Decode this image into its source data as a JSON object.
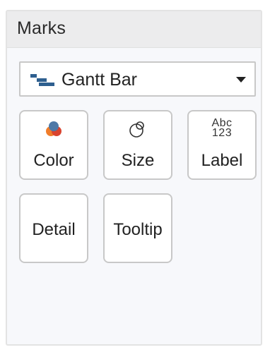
{
  "marks": {
    "title": "Marks",
    "mark_type": {
      "selected": "Gantt Bar",
      "icon": "gantt-bar-icon"
    },
    "cards": [
      {
        "label": "Color",
        "icon": "color-palette-icon"
      },
      {
        "label": "Size",
        "icon": "size-circles-icon"
      },
      {
        "label": "Label",
        "icon": "label-abc123-icon",
        "icon_text_top": "Abc",
        "icon_text_bottom": "123"
      },
      {
        "label": "Detail",
        "icon": ""
      },
      {
        "label": "Tooltip",
        "icon": ""
      }
    ],
    "colors": {
      "gantt_dark": "#1f4e79",
      "gantt_light": "#4f81bd",
      "color_icon_orange": "#f07d2a",
      "color_icon_red": "#d9432f",
      "color_icon_blue": "#4e79a7"
    }
  }
}
